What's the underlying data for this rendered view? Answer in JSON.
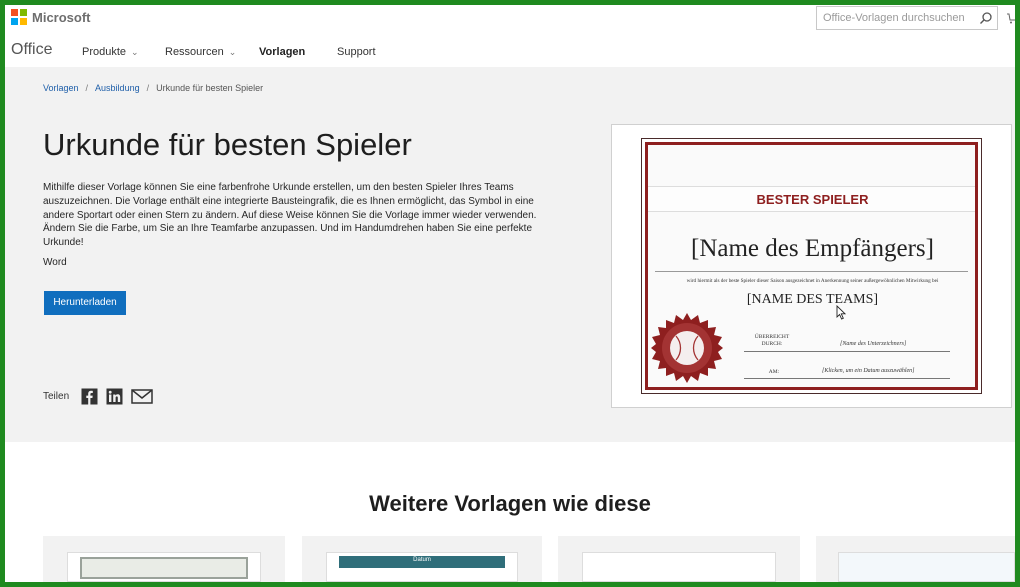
{
  "header": {
    "brand": "Microsoft",
    "brand_colors": [
      "#f25022",
      "#7fba00",
      "#00a4ef",
      "#ffb900"
    ],
    "search_placeholder": "Office-Vorlagen durchsuchen",
    "search_icon": "magnifier-icon",
    "cart_icon": "cart-icon"
  },
  "nav": {
    "office": "Office",
    "items": [
      {
        "label": "Produkte",
        "has_dropdown": true
      },
      {
        "label": "Ressourcen",
        "has_dropdown": true
      },
      {
        "label": "Vorlagen",
        "active": true
      },
      {
        "label": "Support"
      }
    ]
  },
  "breadcrumb": {
    "items": [
      "Vorlagen",
      "Ausbildung"
    ],
    "current": "Urkunde für besten Spieler"
  },
  "template": {
    "title": "Urkunde für besten Spieler",
    "description": "Mithilfe dieser Vorlage können Sie eine farbenfrohe Urkunde erstellen, um den besten Spieler Ihres Teams auszuzeichnen. Die Vorlage enthält eine integrierte Bausteingrafik, die es Ihnen ermöglicht, das Symbol in eine andere Sportart oder einen Stern zu ändern. Auf diese Weise können Sie die Vorlage immer wieder verwenden. Ändern Sie die Farbe, um Sie an Ihre Teamfarbe anzupassen. Und im Handumdrehen haben Sie eine perfekte Urkunde!",
    "app": "Word",
    "download_label": "Herunterladen",
    "share_label": "Teilen",
    "accent_color": "#106ebe"
  },
  "certificate": {
    "heading": "BESTER SPIELER",
    "recipient": "[Name des Empfängers]",
    "line": "wird hiermit als der beste Spieler dieser Saison ausgezeichnet in Anerkennung seiner außergewöhnlichen Mitwirkung bei",
    "team": "[NAME DES TEAMS]",
    "presented_by_label_1": "ÜBERREICHT",
    "presented_by_label_2": "DURCH:",
    "signer": "[Name des Unterzeichners]",
    "date_label": "AM:",
    "date_value": "[Klicken, um ein Datum auszuwählen]",
    "border_color": "#8e1f1f"
  },
  "more": {
    "title": "Weitere Vorlagen wie diese",
    "thumb_label": "Datum"
  }
}
